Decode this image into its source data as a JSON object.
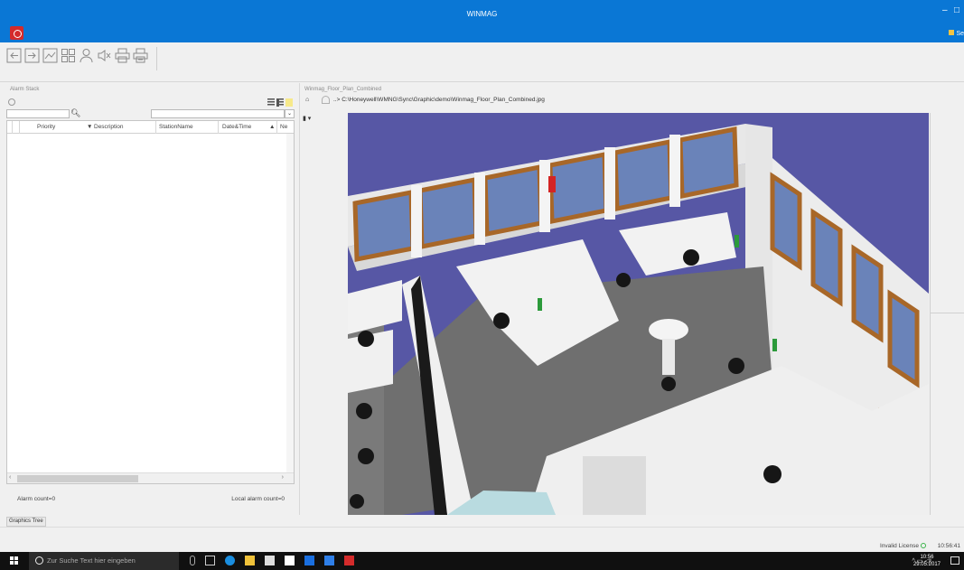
{
  "window": {
    "title": "WINMAG",
    "user_button": "Se"
  },
  "toolbar": {
    "icons": [
      "login-icon",
      "logout-icon",
      "graphic-icon",
      "grid-view-icon",
      "user-icon",
      "mute-icon",
      "print-icon",
      "print-preview-icon"
    ]
  },
  "alarm_stack": {
    "title": "Alarm Stack",
    "search_value": "",
    "filter_value": "",
    "columns": [
      "Priority",
      "Description",
      "StationName",
      "Date&Time",
      "Ne"
    ],
    "rows": [],
    "alarm_count": "Alarm count=0",
    "local_alarm_count": "Local alarm count=0"
  },
  "graphic": {
    "title": "Winmag_Floor_Plan_Combined",
    "path": "..> C:\\Honeywell\\WMNG\\Sync\\Graphic\\demo\\Winmag_Floor_Plan_Combined.jpg",
    "image_description_name": "floor-plan-3d-image"
  },
  "tabs": {
    "graphics_tree": "Graphics Tree"
  },
  "status": {
    "license": "Invalid License",
    "time": "10:56:41"
  },
  "taskbar": {
    "search_placeholder": "Zur Suche Text hier eingeben",
    "clock_time": "10:56",
    "clock_date": "29.05.2017"
  },
  "colors": {
    "titlebar": "#0a77d5",
    "canvas_bg": "#5757a5",
    "brand_red": "#d42b2b"
  }
}
